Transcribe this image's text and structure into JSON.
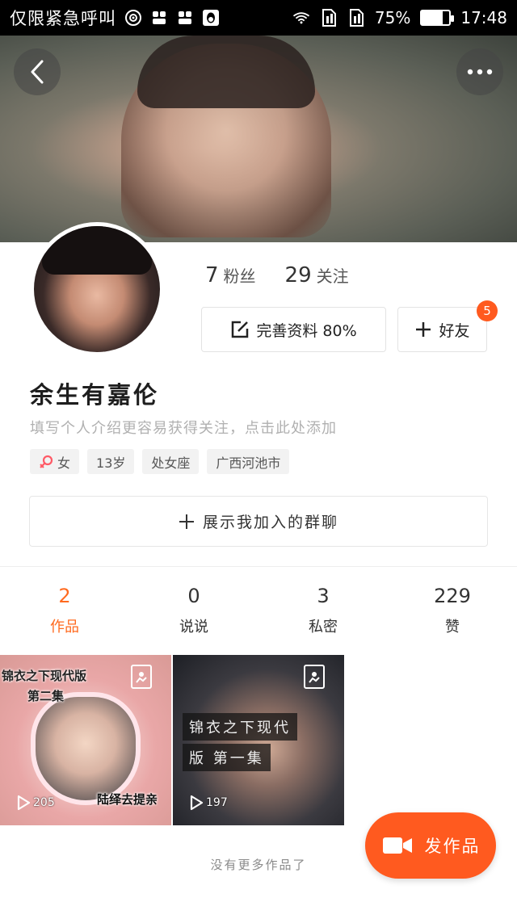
{
  "status_bar": {
    "carrier": "仅限紧急呼叫",
    "battery_percent": "75%",
    "battery_level": 0.75,
    "time": "17:48",
    "icons": [
      "hotspot-icon",
      "bluesignal-icon",
      "bluesignal-icon",
      "qq-icon",
      "wifi-icon",
      "sim1-icon",
      "sim2-icon"
    ]
  },
  "profile": {
    "followers_count": "7",
    "followers_label": "粉丝",
    "following_count": "29",
    "following_label": "关注",
    "complete_profile_label": "完善资料 80%",
    "friends_label": "好友",
    "friends_badge": "5",
    "username": "余生有嘉伦",
    "bio_placeholder": "填写个人介绍更容易获得关注，点击此处添加",
    "tags": [
      "女",
      "13岁",
      "处女座",
      "广西河池市"
    ],
    "groups_button": "展示我加入的群聊"
  },
  "tabs": [
    {
      "count": "2",
      "label": "作品",
      "active": true
    },
    {
      "count": "0",
      "label": "说说",
      "active": false
    },
    {
      "count": "3",
      "label": "私密",
      "active": false
    },
    {
      "count": "229",
      "label": "赞",
      "active": false
    }
  ],
  "works": [
    {
      "title_line1": "锦衣之下现代版",
      "title_line2": "第二集",
      "caption": "陆绎去提亲",
      "plays": "205"
    },
    {
      "caption_line1": "锦衣之下现代",
      "caption_line2": "版 第一集",
      "plays": "197"
    }
  ],
  "footer": {
    "no_more": "没有更多作品了",
    "post_button": "发作品"
  },
  "colors": {
    "accent": "#ff5a1f",
    "active_tab": "#ff6a1f",
    "female": "#ff5a66"
  }
}
